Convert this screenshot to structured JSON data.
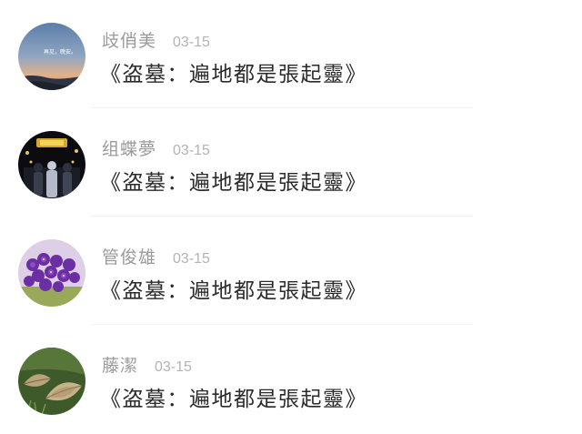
{
  "comments": [
    {
      "avatar_icon": "sky-landscape-avatar",
      "username": "歧俏美",
      "date": "03-15",
      "message": "《盗墓：遍地都是張起靈》",
      "avatar_caption": "再见，晚安。"
    },
    {
      "avatar_icon": "concert-stage-avatar",
      "username": "组蝶夢",
      "date": "03-15",
      "message": "《盗墓：遍地都是張起靈》"
    },
    {
      "avatar_icon": "purple-flowers-avatar",
      "username": "管俊雄",
      "date": "03-15",
      "message": "《盗墓：遍地都是張起靈》"
    },
    {
      "avatar_icon": "leaves-avatar",
      "username": "藤潔",
      "date": "03-15",
      "message": "《盗墓：遍地都是張起靈》"
    }
  ],
  "colors": {
    "username": "#9a9a9a",
    "date": "#b3b3b3",
    "message": "#2a2a2a",
    "divider": "#f1f1f1"
  }
}
